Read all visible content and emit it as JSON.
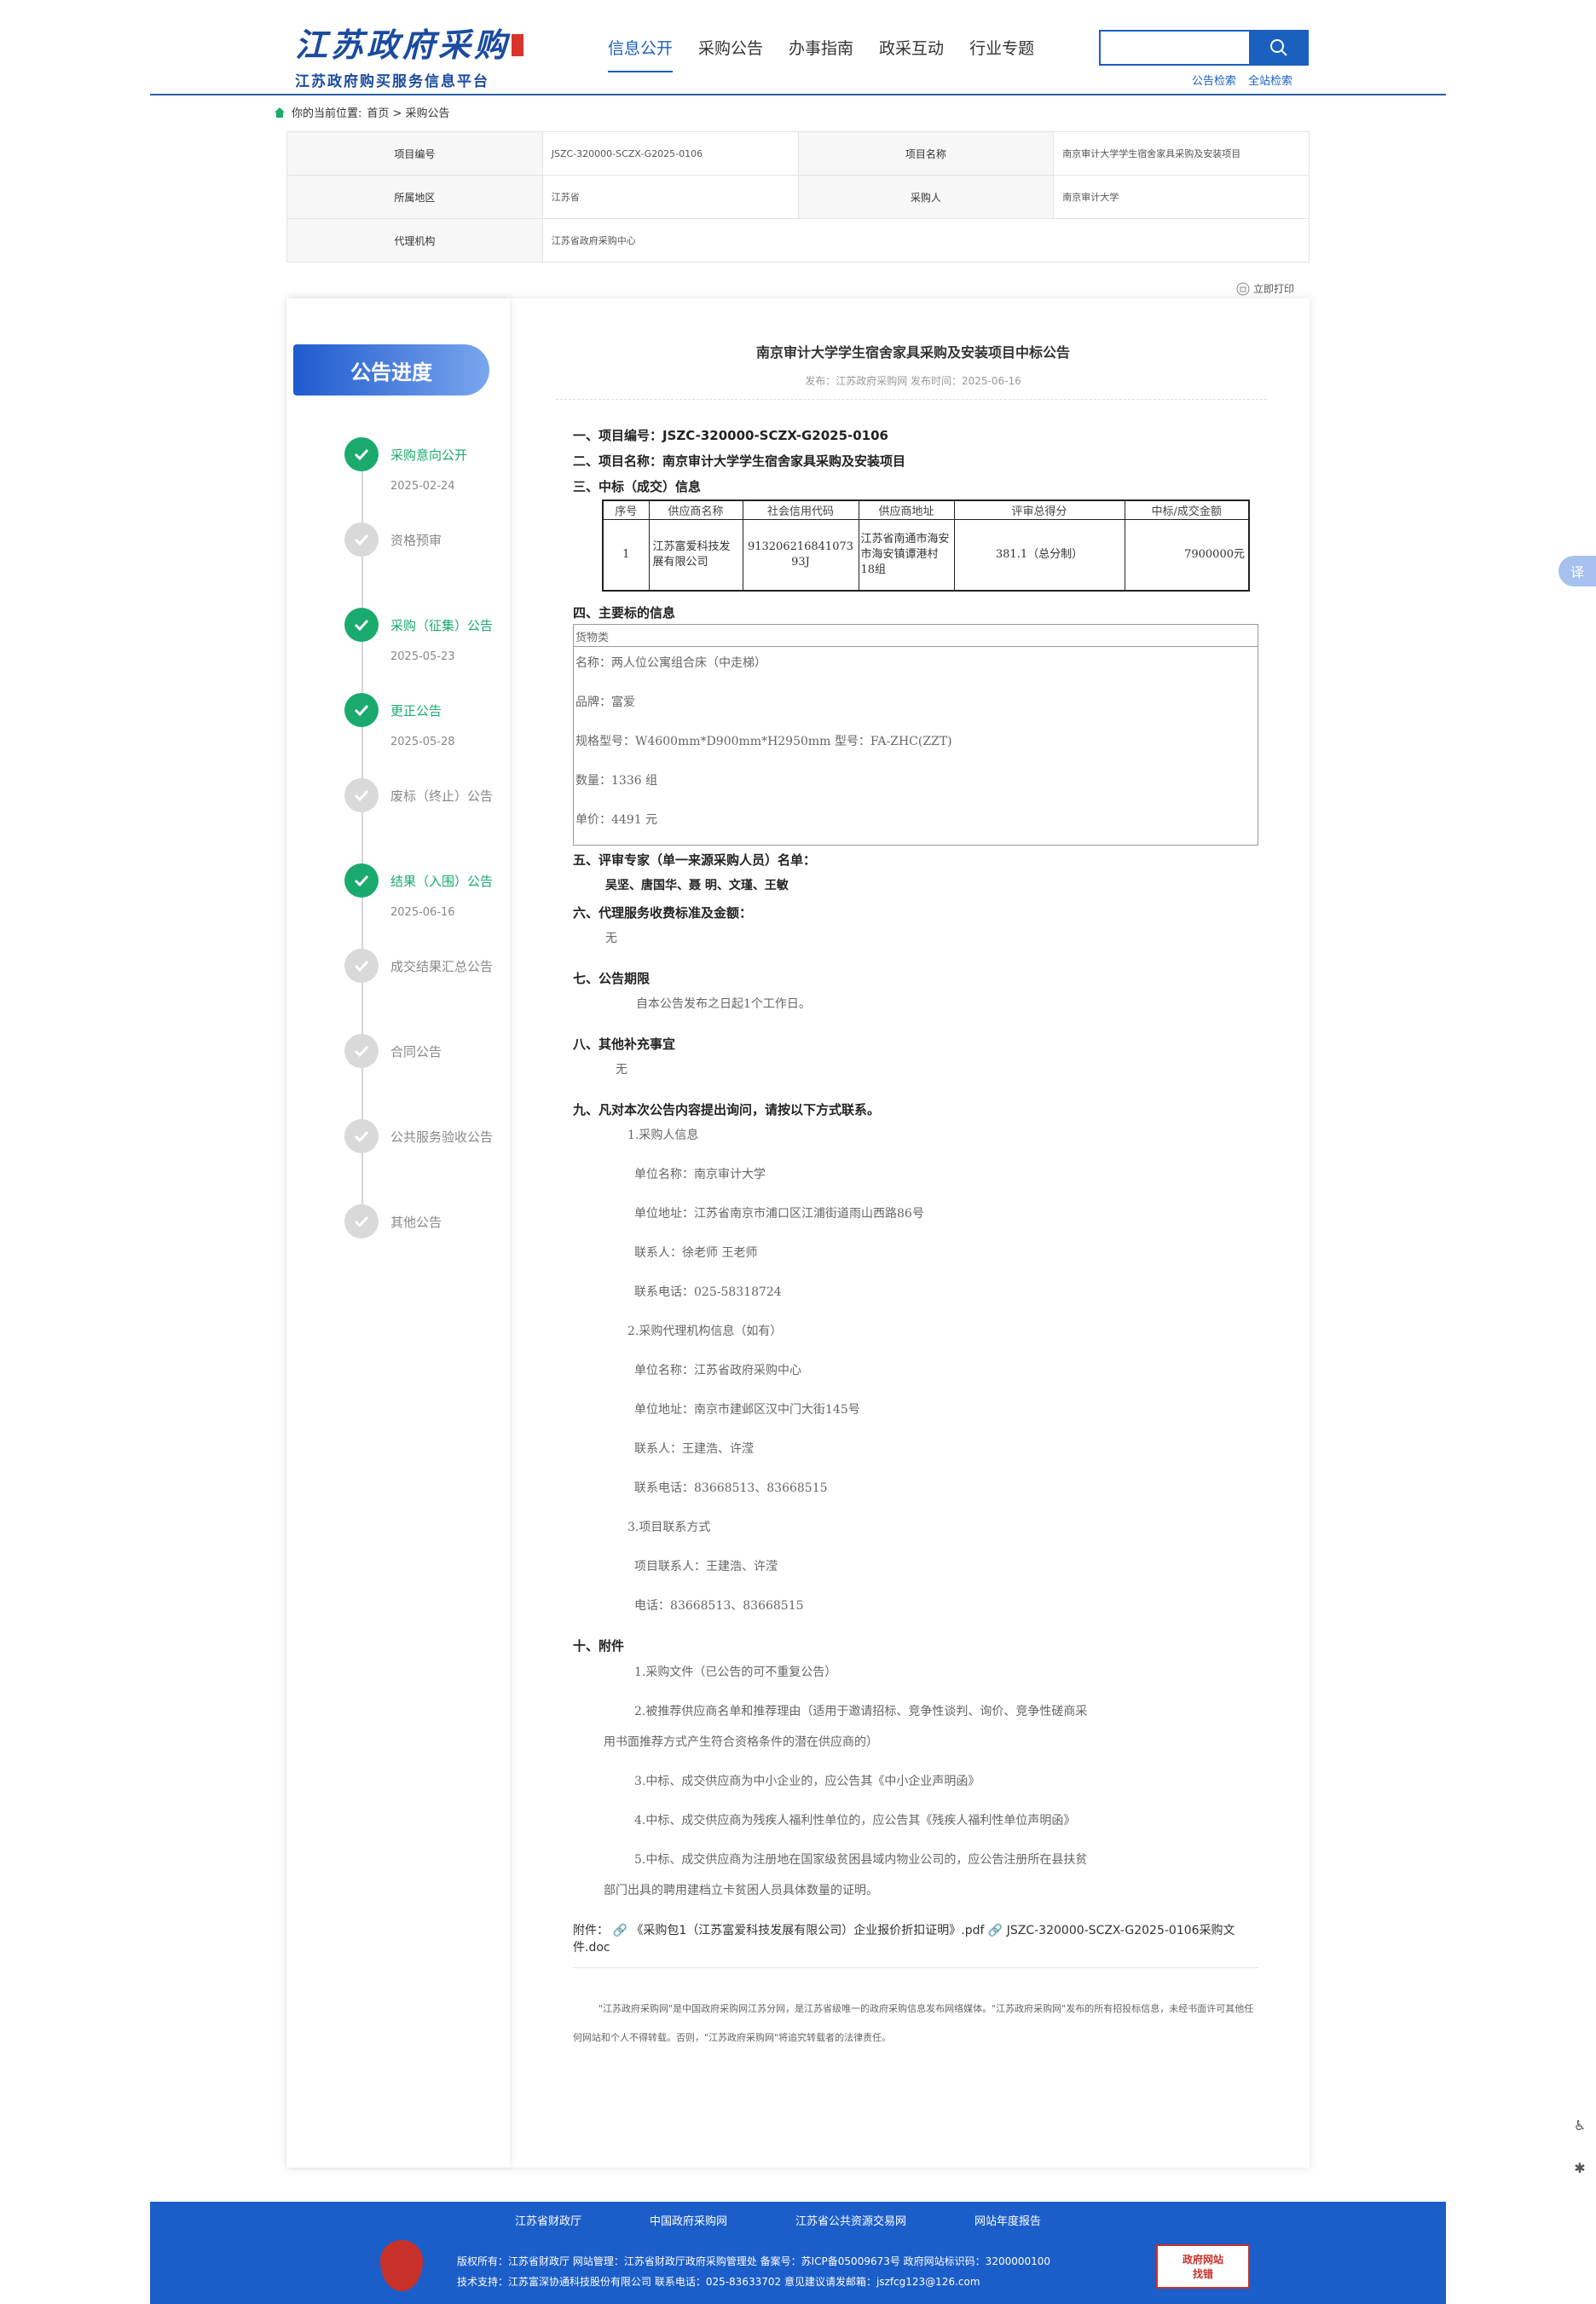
{
  "header": {
    "logo_main": "江苏政府采购",
    "logo_sub": "江苏政府购买服务信息平台",
    "nav": [
      "信息公开",
      "采购公告",
      "办事指南",
      "政采互动",
      "行业专题"
    ],
    "search_links": [
      "公告检索",
      "全站检索"
    ]
  },
  "breadcrumb": {
    "prefix": "你的当前位置:",
    "path": "首页 > 采购公告"
  },
  "info": {
    "project_no_label": "项目编号",
    "project_no": "JSZC-320000-SCZX-G2025-0106",
    "project_name_label": "项目名称",
    "project_name": "南京审计大学学生宿舍家具采购及安装项目",
    "region_label": "所属地区",
    "region": "江苏省",
    "buyer_label": "采购人",
    "buyer": "南京审计大学",
    "agency_label": "代理机构",
    "agency": "江苏省政府采购中心"
  },
  "print_label": "立即打印",
  "progress": {
    "title": "公告进度",
    "steps": [
      {
        "label": "采购意向公开",
        "date": "2025-02-24"
      },
      {
        "label": "资格预审",
        "date": ""
      },
      {
        "label": "采购（征集）公告",
        "date": "2025-05-23"
      },
      {
        "label": "更正公告",
        "date": "2025-05-28"
      },
      {
        "label": "废标（终止）公告",
        "date": ""
      },
      {
        "label": "结果（入围）公告",
        "date": "2025-06-16"
      },
      {
        "label": "成交结果汇总公告",
        "date": ""
      },
      {
        "label": "合同公告",
        "date": ""
      },
      {
        "label": "公共服务验收公告",
        "date": ""
      },
      {
        "label": "其他公告",
        "date": ""
      }
    ]
  },
  "announcement": {
    "title": "南京审计大学学生宿舍家具采购及安装项目中标公告",
    "meta": "发布：江苏政府采购网   发布时间：2025-06-16",
    "s1": "一、项目编号：JSZC-320000-SCZX-G2025-0106",
    "s2": "二、项目名称：南京审计大学学生宿舍家具采购及安装项目",
    "s3": "三、中标（成交）信息",
    "win_headers": [
      "序号",
      "供应商名称",
      "社会信用代码",
      "供应商地址",
      "评审总得分",
      "中标/成交金额"
    ],
    "win_row": [
      "1",
      "江苏富爱科技发展有限公司",
      "91320621684107393J",
      "江苏省南通市海安市海安镇谭港村18组",
      "381.1（总分制）",
      "7900000元"
    ],
    "s4": "四、主要标的信息",
    "goods_head": "货物类",
    "goods": [
      "名称：两人位公寓组合床（中走梯）",
      "品牌：富爱",
      "规格型号：W4600mm*D900mm*H2950mm 型号：FA-ZHC(ZZT)",
      "数量：1336 组",
      "单价：4491 元"
    ],
    "s5": "五、评审专家（单一来源采购人员）名单：",
    "experts": "吴坚、唐国华、聂 明、文瑾、王敏",
    "s6": "六、代理服务收费标准及金额：",
    "fee": "无",
    "s7": "七、公告期限",
    "period": "自本公告发布之日起1个工作日。",
    "s8": "八、其他补充事宜",
    "other": "无",
    "s9": "九、凡对本次公告内容提出询问，请按以下方式联系。",
    "contact": {
      "c1": "1.采购人信息",
      "c1_name": "单位名称：南京审计大学",
      "c1_addr": "单位地址：江苏省南京市浦口区江浦街道雨山西路86号",
      "c1_person": "联系人：徐老师 王老师",
      "c1_tel": "联系电话：025-58318724",
      "c2": "2.采购代理机构信息（如有）",
      "c2_name": "单位名称：江苏省政府采购中心",
      "c2_addr": "单位地址：南京市建邺区汉中门大街145号",
      "c2_person": "联系人：王建浩、许滢",
      "c2_tel": "联系电话：83668513、83668515",
      "c3": "3.项目联系方式",
      "c3_person": "项目联系人：王建浩、许滢",
      "c3_tel": "电话：83668513、83668515"
    },
    "s10": "十、附件",
    "att": {
      "a1": "1.采购文件（已公告的可不重复公告）",
      "a2_line1": "2.被推荐供应商名单和推荐理由（适用于邀请招标、竞争性谈判、询价、竞争性磋商采",
      "a2_line2": "用书面推荐方式产生符合资格条件的潜在供应商的）",
      "a3": "3.中标、成交供应商为中小企业的，应公告其《中小企业声明函》",
      "a4": "4.中标、成交供应商为残疾人福利性单位的，应公告其《残疾人福利性单位声明函》",
      "a5_line1": "5.中标、成交供应商为注册地在国家级贫困县域内物业公司的，应公告注册所在县扶贫",
      "a5_line2": "部门出具的聘用建档立卡贫困人员具体数量的证明。"
    },
    "attach_label": "附件：",
    "attach_file1": "《采购包1（江苏富爱科技发展有限公司）企业报价折扣证明》.pdf",
    "attach_file2": "JSZC-320000-SCZX-G2025-0106采购文件.doc",
    "disclaimer": "\"江苏政府采购网\"是中国政府采购网江苏分网，是江苏省级唯一的政府采购信息发布网络媒体。\"江苏政府采购网\"发布的所有招投标信息，未经书面许可其他任何网站和个人不得转载。否则，\"江苏政府采购网\"将追究转载者的法律责任。"
  },
  "footer": {
    "links": [
      "江苏省财政厅",
      "中国政府采购网",
      "江苏省公共资源交易网",
      "网站年度报告"
    ],
    "line1": "版权所有：江苏省财政厅    网站管理：江苏省财政厅政府采购管理处    备案号：苏ICP备05009673号    政府网站标识码：3200000100",
    "line2": "技术支持：江苏富深协通科技股份有限公司    联系电话：025-83633702    意见建议请发邮箱：jszfcg123@126.com",
    "badge_top": "政府网站",
    "badge_bottom": "找错"
  },
  "side_tab": "译"
}
